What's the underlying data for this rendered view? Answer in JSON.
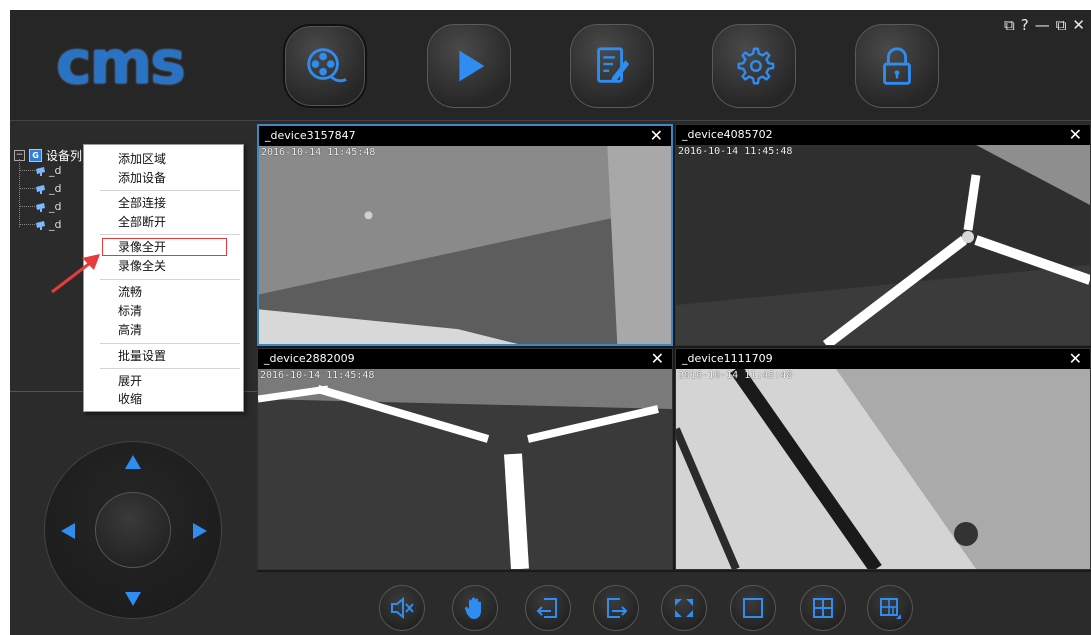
{
  "app": {
    "logo_text": "cms",
    "brand_color": "#2a72c4",
    "accent_color": "#2f8cf0"
  },
  "nav": [
    {
      "id": "preview",
      "icon": "film-reel-icon",
      "active": true
    },
    {
      "id": "playback",
      "icon": "play-icon",
      "active": false
    },
    {
      "id": "log",
      "icon": "document-edit-icon",
      "active": false
    },
    {
      "id": "settings",
      "icon": "gear-icon",
      "active": false
    },
    {
      "id": "lock",
      "icon": "lock-icon",
      "active": false
    }
  ],
  "window_controls": {
    "monitor": "⧉",
    "help": "?",
    "minimize": "—",
    "restore": "⧉",
    "close": "✕"
  },
  "tree": {
    "root_label": "设备列",
    "root_icon_letter": "G",
    "children": [
      "_d",
      "_d",
      "_d",
      "_d"
    ]
  },
  "context_menu": {
    "items": [
      "添加区域",
      "添加设备",
      "全部连接",
      "全部断开",
      "录像全开",
      "录像全关",
      "流畅",
      "标清",
      "高清",
      "批量设置",
      "展开",
      "收缩"
    ],
    "highlighted_index": 4
  },
  "videos": [
    {
      "title": "_device3157847",
      "osd": "2016-10-14  11:45:48",
      "close": "✕"
    },
    {
      "title": "_device4085702",
      "osd": "2016-10-14  11:45:48",
      "close": "✕"
    },
    {
      "title": "_device2882009",
      "osd": "2016-10-14  11:45:48",
      "close": "✕"
    },
    {
      "title": "_device1111709",
      "osd": "2016-10-14  11:45:48",
      "close": "✕"
    }
  ],
  "toolbar": [
    {
      "id": "mute",
      "icon": "mute-icon"
    },
    {
      "id": "hand",
      "icon": "hand-icon"
    },
    {
      "id": "import",
      "icon": "import-icon"
    },
    {
      "id": "export",
      "icon": "export-icon"
    },
    {
      "id": "fullscreen",
      "icon": "fullscreen-icon"
    },
    {
      "id": "layout-1",
      "icon": "single-view-icon"
    },
    {
      "id": "layout-4",
      "icon": "quad-view-icon"
    },
    {
      "id": "layout-custom",
      "icon": "custom-layout-icon"
    }
  ]
}
